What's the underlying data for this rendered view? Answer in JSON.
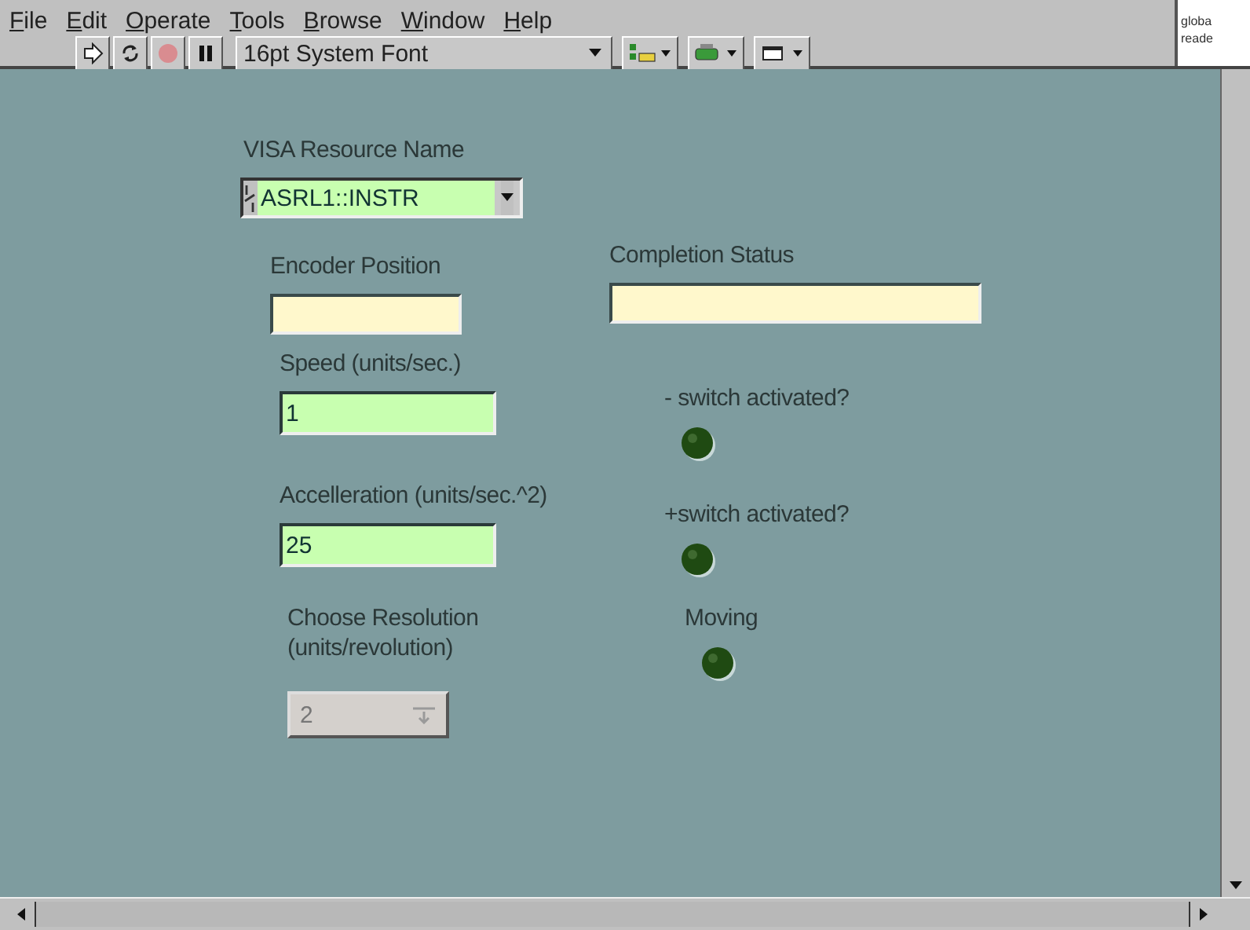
{
  "menu": [
    "File",
    "Edit",
    "Operate",
    "Tools",
    "Browse",
    "Window",
    "Help"
  ],
  "toolbar": {
    "font": "16pt System Font"
  },
  "side_text": [
    "globa",
    "reade"
  ],
  "controls": [
    {
      "kind": "visa",
      "label": "VISA Resource Name",
      "value": "ASRL1::INSTR"
    },
    {
      "kind": "indicator",
      "label": "Encoder Position"
    },
    {
      "kind": "indicator",
      "label": "Completion Status"
    },
    {
      "kind": "numeric",
      "label": "Speed (units/sec.)",
      "value": "1"
    },
    {
      "kind": "led",
      "label": "- switch activated?",
      "on": false
    },
    {
      "kind": "numeric",
      "label": "Accelleration (units/sec.^2)",
      "value": "25"
    },
    {
      "kind": "led",
      "label": "+switch activated?",
      "on": false
    },
    {
      "kind": "ring",
      "label": "Choose Resolution\n(units/revolution)",
      "value": "2",
      "disabled": true
    },
    {
      "kind": "led",
      "label": "Moving",
      "on": false
    }
  ]
}
